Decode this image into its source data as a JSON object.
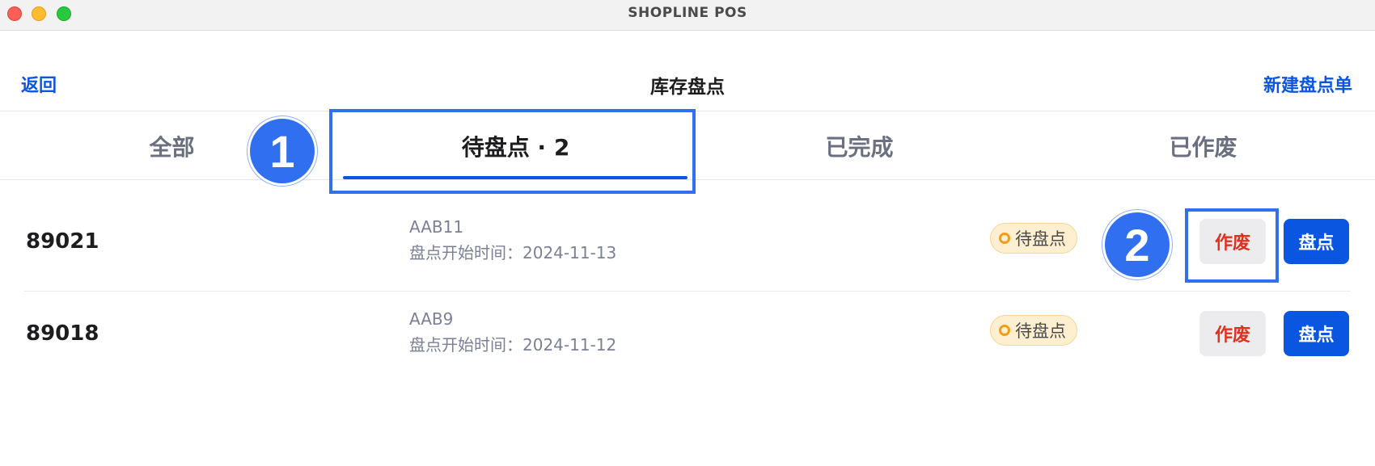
{
  "window": {
    "title": "SHOPLINE POS"
  },
  "navbar": {
    "back_label": "返回",
    "title": "库存盘点",
    "new_label": "新建盘点单"
  },
  "tabs": [
    {
      "label": "全部",
      "active": false
    },
    {
      "label": "待盘点 · 2",
      "active": true
    },
    {
      "label": "已完成",
      "active": false
    },
    {
      "label": "已作废",
      "active": false
    }
  ],
  "annotations": {
    "step1": "1",
    "step2": "2"
  },
  "colors": {
    "accent": "#0a56e0",
    "void_text": "#e0301e",
    "pending_bg": "#fdefcf",
    "pending_dot": "#f29d15",
    "annotation": "#2f6ff0"
  },
  "rows": [
    {
      "id": "89021",
      "code": "AAB11",
      "start": "盘点开始时间：2024-11-13",
      "status": "待盘点",
      "void_label": "作废",
      "count_label": "盘点"
    },
    {
      "id": "89018",
      "code": "AAB9",
      "start": "盘点开始时间：2024-11-12",
      "status": "待盘点",
      "void_label": "作废",
      "count_label": "盘点"
    }
  ]
}
